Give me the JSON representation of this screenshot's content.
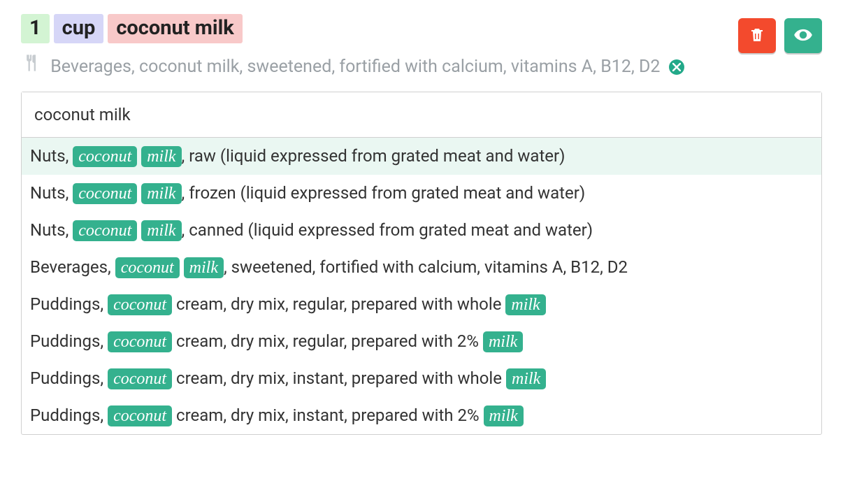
{
  "ingredient": {
    "quantity": "1",
    "unit": "cup",
    "name": "coconut milk",
    "description": "Beverages, coconut milk, sweetened, fortified with calcium, vitamins A, B12, D2"
  },
  "search": {
    "value": "coconut milk",
    "highlight_terms": [
      "coconut",
      "milk"
    ],
    "suggestions": [
      {
        "text": "Nuts, coconut milk, raw (liquid expressed from grated meat and water)",
        "selected": true
      },
      {
        "text": "Nuts, coconut milk, frozen (liquid expressed from grated meat and water)",
        "selected": false
      },
      {
        "text": "Nuts, coconut milk, canned (liquid expressed from grated meat and water)",
        "selected": false
      },
      {
        "text": "Beverages, coconut milk, sweetened, fortified with calcium, vitamins A, B12, D2",
        "selected": false
      },
      {
        "text": "Puddings, coconut cream, dry mix, regular, prepared with whole milk",
        "selected": false
      },
      {
        "text": "Puddings, coconut cream, dry mix, regular, prepared with 2% milk",
        "selected": false
      },
      {
        "text": "Puddings, coconut cream, dry mix, instant, prepared with whole milk",
        "selected": false
      },
      {
        "text": "Puddings, coconut cream, dry mix, instant, prepared with 2% milk",
        "selected": false
      }
    ]
  },
  "icons": {
    "utensils": "utensils-icon",
    "close": "close-icon",
    "trash": "trash-icon",
    "eye": "eye-icon"
  }
}
